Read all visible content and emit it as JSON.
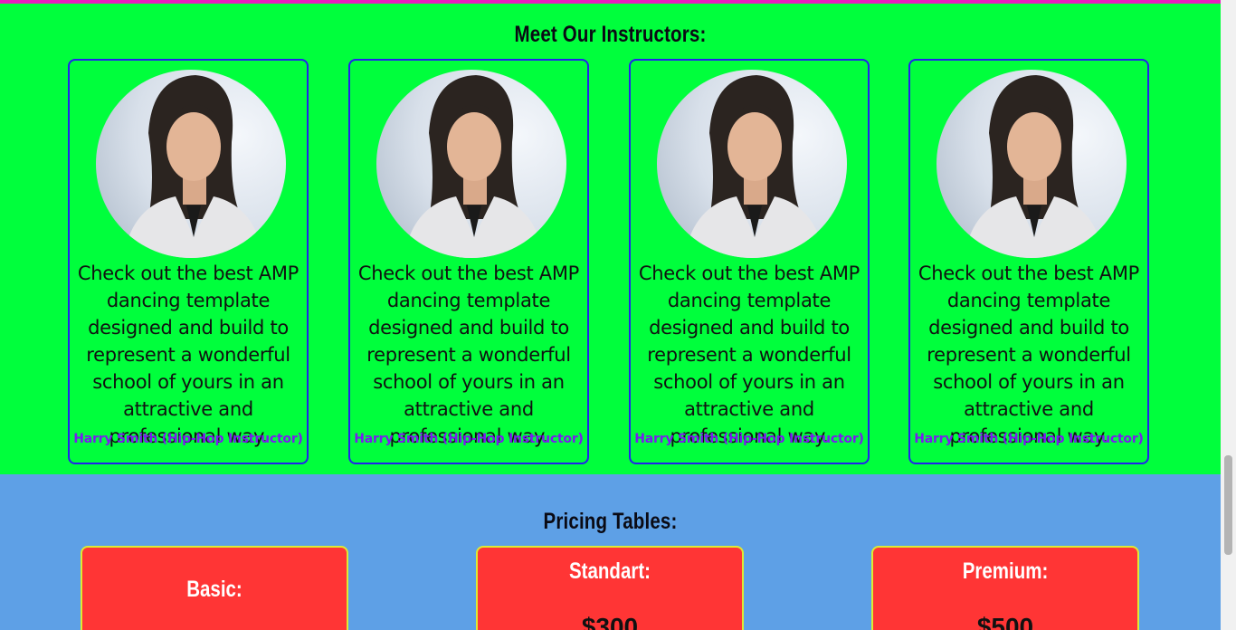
{
  "instructors": {
    "title": "Meet Our Instructors:",
    "cards": [
      {
        "text": "Check out the best AMP dancing template designed and build to represent a wonderful school of yours in an attractive and professional way.",
        "name": "Harry Smith (Hip-Hop Instructor)"
      },
      {
        "text": "Check out the best AMP dancing template designed and build to represent a wonderful school of yours in an attractive and professional way.",
        "name": "Harry Smith (Hip-Hop Instructor)"
      },
      {
        "text": "Check out the best AMP dancing template designed and build to represent a wonderful school of yours in an attractive and professional way.",
        "name": "Harry Smith (Hip-Hop Instructor)"
      },
      {
        "text": "Check out the best AMP dancing template designed and build to represent a wonderful school of yours in an attractive and professional way.",
        "name": "Harry Smith (Hip-Hop Instructor)"
      }
    ]
  },
  "pricing": {
    "title": "Pricing Tables:",
    "plans": [
      {
        "name": "Basic:",
        "price": ""
      },
      {
        "name": "Standart:",
        "price": "$300"
      },
      {
        "name": "Premium:",
        "price": "$500"
      }
    ]
  },
  "colors": {
    "instructors_bg": "#00ff3c",
    "pricing_bg": "#5ea0e6",
    "card_border": "#2222ee",
    "instructor_name": "#7a1cf0",
    "price_card_bg": "#ff3535",
    "price_card_border": "#ddea33"
  }
}
